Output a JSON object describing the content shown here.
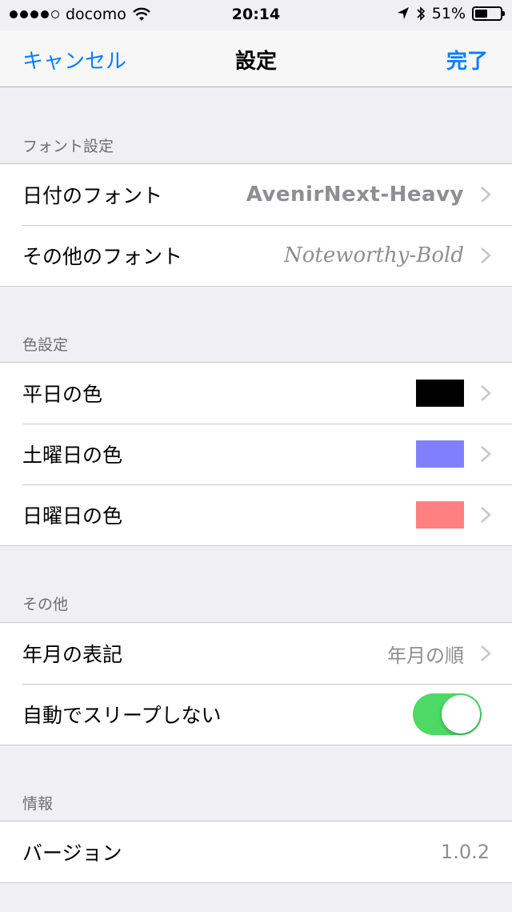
{
  "status_bar": {
    "carrier": "docomo",
    "time": "20:14",
    "battery_percent": "51%",
    "battery_level": 0.51,
    "signal_icon": "signal-dots-icon",
    "wifi_icon": "wifi-icon",
    "location_icon": "location-arrow-icon",
    "bluetooth_icon": "bluetooth-icon"
  },
  "nav": {
    "cancel_label": "キャンセル",
    "title": "設定",
    "done_label": "完了"
  },
  "sections": {
    "font": {
      "header": "フォント設定",
      "date_font_label": "日付のフォント",
      "date_font_value": "AvenirNext-Heavy",
      "other_font_label": "その他のフォント",
      "other_font_value": "Noteworthy-Bold"
    },
    "color": {
      "header": "色設定",
      "weekday_label": "平日の色",
      "weekday_color": "#000000",
      "saturday_label": "土曜日の色",
      "saturday_color": "#8080ff",
      "sunday_label": "日曜日の色",
      "sunday_color": "#ff8080"
    },
    "other": {
      "header": "その他",
      "date_format_label": "年月の表記",
      "date_format_value": "年月の順",
      "no_sleep_label": "自動でスリープしない",
      "no_sleep_on": true
    },
    "info": {
      "header": "情報",
      "version_label": "バージョン",
      "version_value": "1.0.2"
    }
  },
  "colors": {
    "accent": "#0a7cff",
    "toggle_on": "#4cd964",
    "background": "#efeff4"
  }
}
